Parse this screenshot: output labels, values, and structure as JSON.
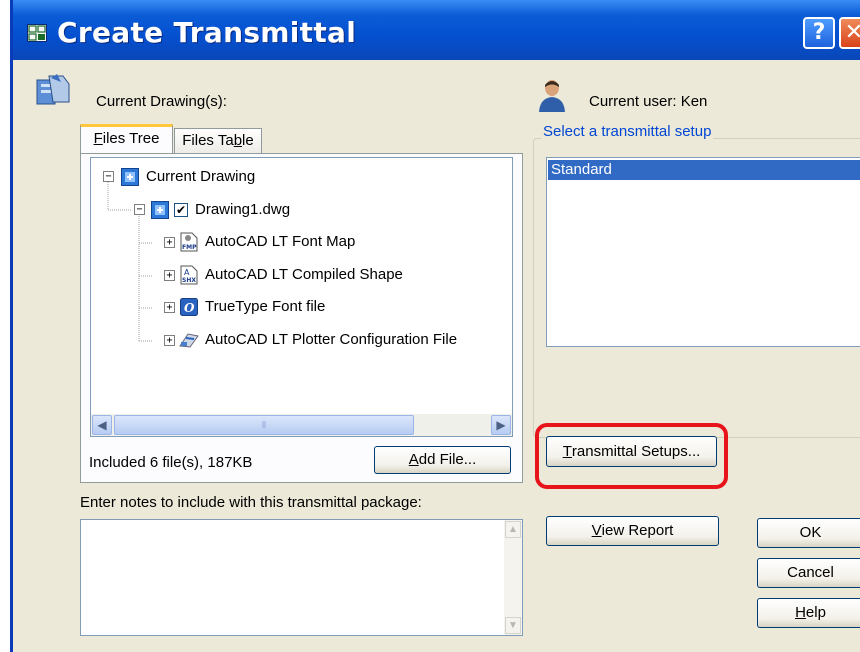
{
  "window": {
    "title": "Create Transmittal",
    "help_glyph": "?",
    "close_glyph": "✕"
  },
  "left": {
    "current_drawings_label": "Current Drawing(s):",
    "tabs": [
      {
        "label": "Files Tree",
        "underline_char": "F",
        "rest": "iles Tree",
        "active": true
      },
      {
        "label": "Files Table",
        "prefix": "Files Ta",
        "underline_char": "b",
        "rest": "le",
        "active": false
      }
    ],
    "tree": [
      {
        "label": "Current Drawing",
        "level": 0,
        "expander": "−",
        "icon": "current-drawing-icon"
      },
      {
        "label": "Drawing1.dwg",
        "level": 1,
        "expander": "−",
        "icon": "drawing-icon",
        "checked": true
      },
      {
        "label": "AutoCAD LT Font Map",
        "level": 2,
        "expander": "+",
        "icon": "font-map-icon"
      },
      {
        "label": "AutoCAD LT Compiled Shape",
        "level": 2,
        "expander": "+",
        "icon": "compiled-shape-icon"
      },
      {
        "label": "TrueType Font file",
        "level": 2,
        "expander": "+",
        "icon": "truetype-font-icon"
      },
      {
        "label": "AutoCAD LT Plotter Configuration File",
        "level": 2,
        "expander": "+",
        "icon": "plotter-config-icon"
      }
    ],
    "included_text": "Included 6 file(s), 187KB",
    "add_file_button": {
      "underline_char": "A",
      "rest": "dd File..."
    },
    "notes_label": "Enter notes to include with this transmittal package:",
    "notes_value": ""
  },
  "right": {
    "current_user_label": "Current user: Ken",
    "select_setup_label": "Select a transmittal setup",
    "setups": [
      "Standard"
    ],
    "selected_setup": "Standard",
    "transmittal_setups_button": {
      "underline_char": "T",
      "rest": "ransmittal Setups..."
    },
    "view_report_button": {
      "underline_char": "V",
      "rest": "iew Report"
    },
    "ok_button": "OK",
    "cancel_button": "Cancel",
    "help_button": {
      "underline_char": "H",
      "rest": "elp"
    }
  },
  "colors": {
    "dialog_bg": "#ece9d8",
    "titlebar_blue": "#0550d0",
    "selection_blue": "#316ac5",
    "link_blue": "#0046d5",
    "highlight_red": "#e8141c"
  }
}
